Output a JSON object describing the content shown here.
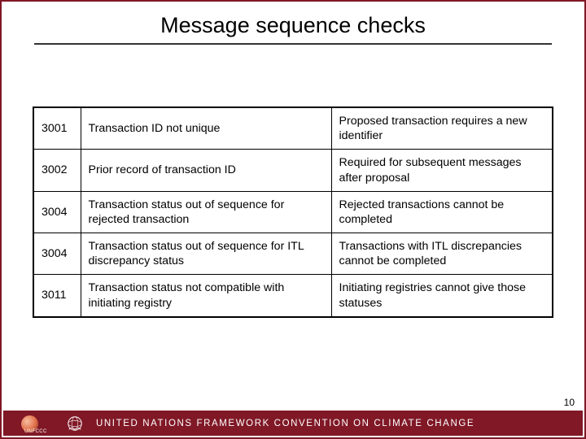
{
  "title": "Message sequence checks",
  "rows": [
    {
      "code": "3001",
      "desc": "Transaction ID not unique",
      "note": "Proposed transaction requires a new identifier"
    },
    {
      "code": "3002",
      "desc": "Prior record of transaction ID",
      "note": "Required for subsequent messages after proposal"
    },
    {
      "code": "3004",
      "desc": "Transaction status out of sequence for rejected transaction",
      "note": "Rejected transactions cannot be completed"
    },
    {
      "code": "3004",
      "desc": "Transaction status out of sequence for ITL discrepancy status",
      "note": "Transactions with ITL discrepancies cannot be completed"
    },
    {
      "code": "3011",
      "desc": "Transaction status not compatible with initiating registry",
      "note": "Initiating registries cannot give those statuses"
    }
  ],
  "footer": {
    "org_abbrev": "UNFCCC",
    "org_full": "UNITED NATIONS FRAMEWORK CONVENTION ON CLIMATE CHANGE"
  },
  "page_number": "10"
}
